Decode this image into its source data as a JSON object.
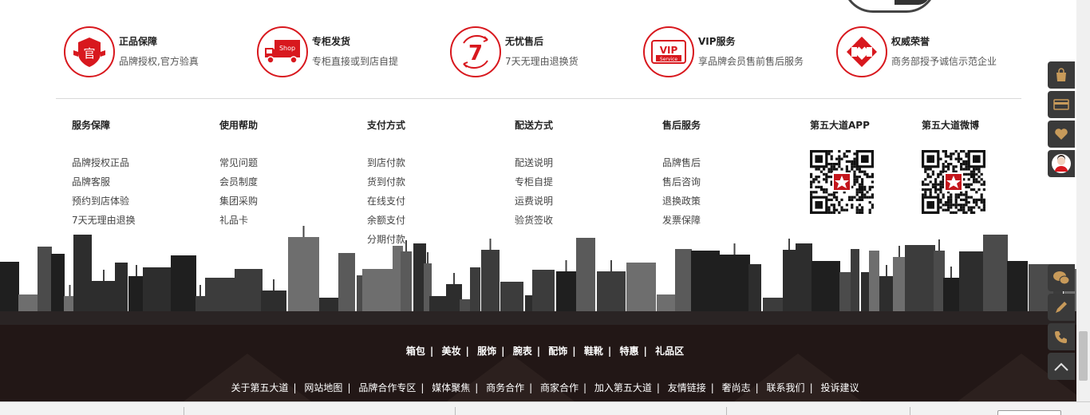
{
  "promises": [
    {
      "title": "正品保障",
      "desc": "品牌授权,官方验真",
      "icon": "official-badge-icon",
      "glyph": "官"
    },
    {
      "title": "专柜发货",
      "desc": "专柜直接或到店自提",
      "icon": "shop-truck-icon",
      "glyph": "Shop"
    },
    {
      "title": "无忧售后",
      "desc": "7天无理由退换货",
      "icon": "seven-day-return-icon",
      "glyph": "7"
    },
    {
      "title": "VIP服务",
      "desc": "享品牌会员售前售后服务",
      "icon": "vip-service-icon",
      "glyph": "VIP",
      "glyph2": "Service"
    },
    {
      "title": "权威荣誉",
      "desc": "商务部授予诚信示范企业",
      "icon": "honor-logo-icon"
    }
  ],
  "columns": [
    {
      "title": "服务保障",
      "items": [
        "品牌授权正品",
        "品牌客服",
        "预约到店体验",
        "7天无理由退换"
      ]
    },
    {
      "title": "使用帮助",
      "items": [
        "常见问题",
        "会员制度",
        "集团采购",
        "礼品卡"
      ]
    },
    {
      "title": "支付方式",
      "items": [
        "到店付款",
        "货到付款",
        "在线支付",
        "余额支付",
        "分期付款"
      ]
    },
    {
      "title": "配送方式",
      "items": [
        "配送说明",
        "专柜自提",
        "运费说明",
        "验货签收"
      ]
    },
    {
      "title": "售后服务",
      "items": [
        "品牌售后",
        "售后咨询",
        "退换政策",
        "发票保障"
      ]
    }
  ],
  "qrcodes": [
    {
      "title": "第五大道APP",
      "icon": "app-qr-code-icon"
    },
    {
      "title": "第五大道微博",
      "icon": "weibo-qr-code-icon"
    }
  ],
  "categories": [
    "箱包",
    "美妆",
    "服饰",
    "腕表",
    "配饰",
    "鞋靴",
    "特惠",
    "礼品区"
  ],
  "footer_links": [
    "关于第五大道",
    "网站地图",
    "品牌合作专区",
    "媒体聚焦",
    "商务合作",
    "商家合作",
    "加入第五大道",
    "友情链接",
    "奢尚志",
    "联系我们",
    "投诉建议"
  ],
  "sidebar_tools": [
    "shopping-bag-icon",
    "card-icon",
    "heart-icon",
    "customer-avatar-icon",
    "wechat-icon",
    "edit-pen-icon",
    "phone-icon",
    "back-to-top-icon"
  ],
  "colors": {
    "accent": "#d8181e",
    "footer_bg": "#221716",
    "side_btn": "#3a3a3a"
  }
}
